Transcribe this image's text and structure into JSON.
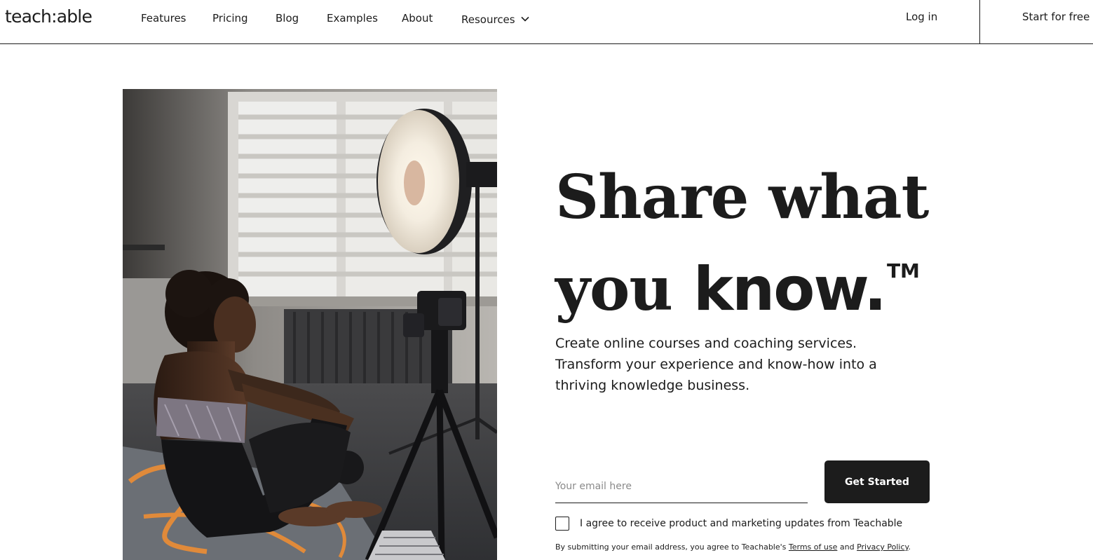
{
  "header": {
    "logo": "teach:able",
    "nav": [
      {
        "label": "Features"
      },
      {
        "label": "Pricing"
      },
      {
        "label": "Blog"
      },
      {
        "label": "Examples"
      },
      {
        "label": "About"
      },
      {
        "label": "Resources"
      }
    ],
    "login_label": "Log in",
    "start_label": "Start for free"
  },
  "hero": {
    "headline_line1": "Share what",
    "headline_line2_serif": "you",
    "headline_line2_sans": "know.",
    "trademark": "TM",
    "subhead_lines": [
      "Create online courses and coaching services.",
      "Transform your experience and know-how into a",
      "thriving knowledge business."
    ],
    "email_placeholder": "Your email here",
    "email_value": "",
    "cta_label": "Get Started",
    "consent_label": "I agree to receive product and marketing updates from Teachable",
    "consent_checked": false,
    "legal_prefix": "By submitting your email address, you agree to Teachable's",
    "legal_terms": "Terms of use",
    "legal_and": "and",
    "legal_privacy": "Privacy Policy",
    "legal_suffix": "."
  },
  "colors": {
    "ink": "#1c1c1c",
    "cta_bg": "#1c1c1c",
    "cta_text": "#ffffff",
    "placeholder": "#8a8a8a"
  },
  "icons": {
    "resources_caret": "chevron-down-icon"
  }
}
